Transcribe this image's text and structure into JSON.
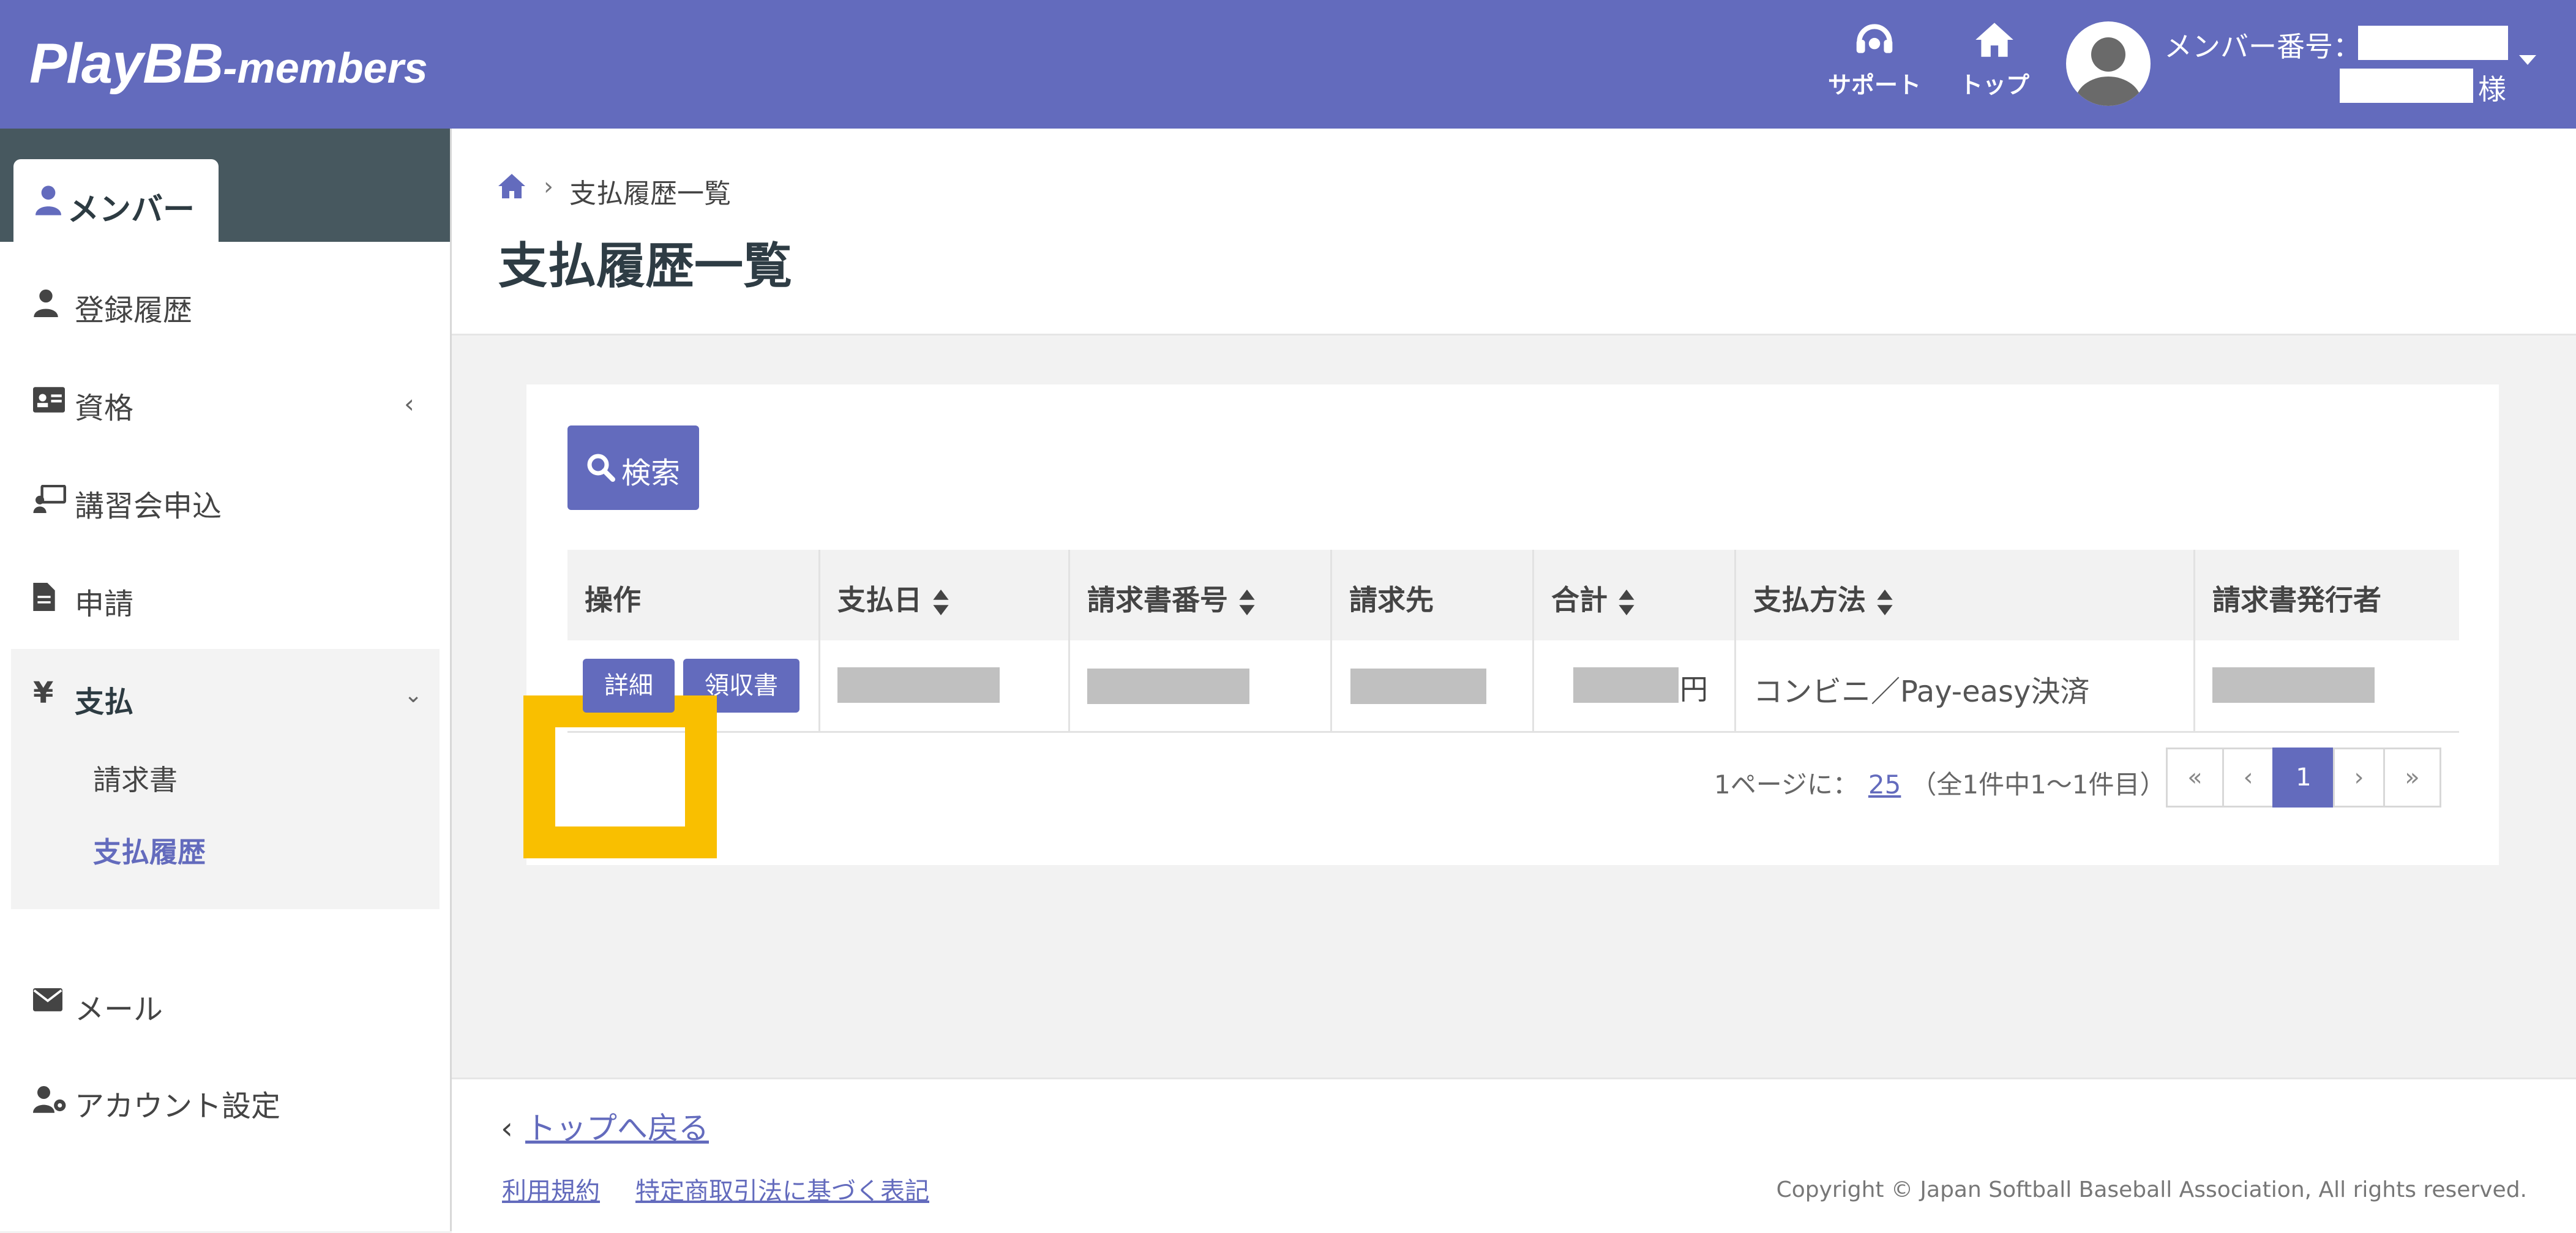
{
  "header": {
    "logo_main": "PlayBB",
    "logo_sub": "-members",
    "support_label": "サポート",
    "top_label": "トップ",
    "member_number_label": "メンバー番号：",
    "honorific": "様"
  },
  "sidebar": {
    "section_tab": "メンバー",
    "items": [
      {
        "label": "登録履歴",
        "icon": "user-icon"
      },
      {
        "label": "資格",
        "icon": "id-card-icon"
      },
      {
        "label": "講習会申込",
        "icon": "chalkboard-user-icon"
      },
      {
        "label": "申請",
        "icon": "file-icon"
      },
      {
        "label": "支払",
        "icon": "yen-icon"
      },
      {
        "label": "メール",
        "icon": "envelope-icon"
      },
      {
        "label": "アカウント設定",
        "icon": "user-gear-icon"
      }
    ],
    "pay_sub_items": [
      "請求書",
      "支払履歴"
    ]
  },
  "breadcrumb": {
    "current": "支払履歴一覧"
  },
  "page_title": "支払履歴一覧",
  "search_button": "検索",
  "table": {
    "columns": [
      "操作",
      "支払日",
      "請求書番号",
      "請求先",
      "合計",
      "支払方法",
      "請求書発行者"
    ],
    "row": {
      "detail_button": "詳細",
      "receipt_button": "領収書",
      "currency": "円",
      "payment_method": "コンビニ／Pay-easy決済"
    }
  },
  "pagination": {
    "per_page_label": "1ページに：",
    "per_page_value": "25",
    "range_text": "（全1件中1～1件目）",
    "first": "«",
    "prev": "‹",
    "current": "1",
    "next": "›",
    "last": "»"
  },
  "footer": {
    "back_link": "トップへ戻る",
    "terms": "利用規約",
    "commerce_law": "特定商取引法に基づく表記",
    "copyright": "Copyright © Japan Softball Baseball Association, All rights reserved."
  },
  "colors": {
    "accent": "#636bbd",
    "sidebar_dark": "#47585f",
    "highlight": "#f9bf00"
  }
}
